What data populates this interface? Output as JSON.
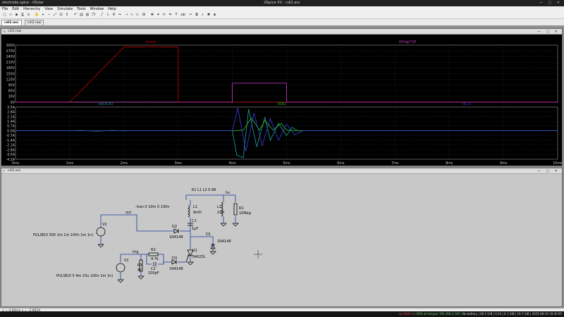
{
  "titlebar": {
    "left": "electrode.spice - ltSolar",
    "title": "LTspice XV - cdi2.asc",
    "controls": "— ▢ ✕"
  },
  "menu": [
    "File",
    "Edit",
    "Hierarchy",
    "View",
    "Simulate",
    "Tools",
    "Window",
    "Help"
  ],
  "toolbar_icons": [
    "new-icon",
    "open-icon",
    "save-icon",
    "print-icon",
    "run-icon",
    "pause-icon",
    "zoom-in-icon",
    "zoom-out-icon",
    "zoom-fit-icon",
    "zoom-area-icon",
    "autoscale-icon",
    "undo-icon",
    "tile-horizontal-icon",
    "tile-vertical-icon",
    "cascade-icon",
    "wire-icon",
    "ground-icon",
    "label-icon",
    "resistor-icon",
    "capacitor-icon",
    "inductor-icon",
    "diode-icon",
    "component-icon",
    "move-icon",
    "drag-icon",
    "rotate-icon",
    "mirror-icon",
    "text-icon",
    "spice-directive-icon",
    "cut-icon",
    "copy-icon",
    "find-icon",
    "delete-icon",
    "duplicate-icon"
  ],
  "tabs": [
    {
      "label": "cdi2.asc",
      "active": true
    },
    {
      "label": "cdi2.raw",
      "active": false
    }
  ],
  "plot_window": {
    "title": "cdi2.raw"
  },
  "schematic_window": {
    "title": "cdi2.asc"
  },
  "status": {
    "coords": "x = 4.00ms    y = -3.662A"
  },
  "taskbar": {
    "left_red": "no (Full) ➜",
    "mid_green": "( 60% at hotspa) 192.168.2.100 |",
    "rest": "No battery | 60.5 GiB | 0.24 | 6.1 GiB | 10.7 GiB | 2025-08-19 16:20:05"
  },
  "chart_data": [
    {
      "type": "line",
      "title": "",
      "xlabel": "",
      "ylabel": "",
      "xlim": [
        0,
        10
      ],
      "ylim": [
        0,
        300
      ],
      "x_unit": "ms",
      "y_ticks": [
        "300V",
        "270V",
        "240V",
        "210V",
        "180V",
        "150V",
        "120V",
        "90V",
        "60V",
        "30V",
        "0V"
      ],
      "legend": [
        "V(out)",
        "V(trig)*20"
      ],
      "series": [
        {
          "name": "V(out)",
          "color": "#c00000",
          "x": [
            0,
            1,
            2,
            3,
            3,
            10
          ],
          "y": [
            0,
            0,
            290,
            290,
            0,
            0
          ]
        },
        {
          "name": "V(trig)*20",
          "color": "#d33bd3",
          "x": [
            0,
            4,
            4,
            5,
            5,
            10
          ],
          "y": [
            0,
            0,
            100,
            100,
            0,
            0
          ]
        }
      ],
      "grid": true
    },
    {
      "type": "line",
      "title": "",
      "xlabel": "",
      "ylabel": "",
      "xlim": [
        0,
        10
      ],
      "ylim": [
        -4.2,
        3.5
      ],
      "x_unit": "ms",
      "y_ticks": [
        "3.5A",
        "2.8A",
        "2.1A",
        "1.4A",
        "0.7A",
        "0.0A",
        "-0.7A",
        "-1.4A",
        "-2.1A",
        "-2.8A",
        "-3.5A",
        "-4.2A"
      ],
      "x_ticks": [
        "0ms",
        "1ms",
        "2ms",
        "3ms",
        "4ms",
        "5ms",
        "6ms",
        "7ms",
        "8ms",
        "9ms",
        "10ms"
      ],
      "legend": [
        "Ix(U1:K)",
        "I(D1)",
        "I(C1)"
      ],
      "series": [
        {
          "name": "Ix(U1:K)",
          "color": "#1aa3a3",
          "x": [
            0,
            1,
            1.2,
            1.5,
            1.8,
            2.0,
            2.1,
            4.0,
            4.08,
            4.2,
            4.3,
            4.45,
            4.6,
            4.7,
            4.85,
            5.0,
            5.1,
            5.2,
            10
          ],
          "y": [
            0,
            0,
            0.05,
            -0.05,
            0.05,
            -0.03,
            0,
            0,
            -3.6,
            -4.0,
            3.2,
            -2.4,
            2.0,
            -1.4,
            1.1,
            -0.7,
            0.5,
            0,
            0
          ]
        },
        {
          "name": "I(D1)",
          "color": "#2bc42b",
          "x": [
            0,
            1,
            2.1,
            4.0,
            4.2,
            4.35,
            4.5,
            4.6,
            4.75,
            4.9,
            5.0,
            5.2,
            10
          ],
          "y": [
            0,
            0,
            0,
            0,
            0.1,
            1.9,
            0.1,
            1.5,
            0.1,
            1.1,
            0.1,
            0,
            0
          ]
        },
        {
          "name": "I(C1)",
          "color": "#3c3cdc",
          "x": [
            0,
            4.0,
            4.1,
            4.25,
            4.4,
            4.55,
            4.7,
            4.85,
            5.0,
            5.15,
            5.3,
            10
          ],
          "y": [
            0,
            0,
            3.4,
            -3.0,
            2.6,
            -2.2,
            1.8,
            -1.4,
            1.0,
            -0.6,
            0,
            0
          ]
        }
      ],
      "grid": true
    }
  ],
  "schematic": {
    "directive_tran": ".tran 0 10m 0 100n",
    "directive_k": "K1 L1 L2 0.98",
    "net_out": "out",
    "net_hv": "hv",
    "net_trig": "trig",
    "V2_name": "V2",
    "V2_value": "PULSE(0 300 1m 1m 100n 1m 1n)",
    "V1_name": "V1",
    "V1_value": "PULSE(0 5 4m 10u 100n 1m 1n)",
    "L1_name": "L1",
    "L1_value": "9mH",
    "L2_name": "L2",
    "L2_value": "23H",
    "R1_name": "R1",
    "R1_value": "10Meg",
    "C1_name": "C1",
    "C1_value": "1µF",
    "D2_name": "D2",
    "D2_value": "1N4148",
    "D1_name": "D1",
    "D1_value": "1N4148",
    "D3_name": "D3",
    "D3_value": "1N4148",
    "R2_name": "R2",
    "R2_value": "4.7k",
    "C2_name": "C2",
    "C2_value": "100pF",
    "R3_name": "R3",
    "R3_value": "47",
    "U1_name": "U1",
    "U1_value": "S4025L"
  }
}
